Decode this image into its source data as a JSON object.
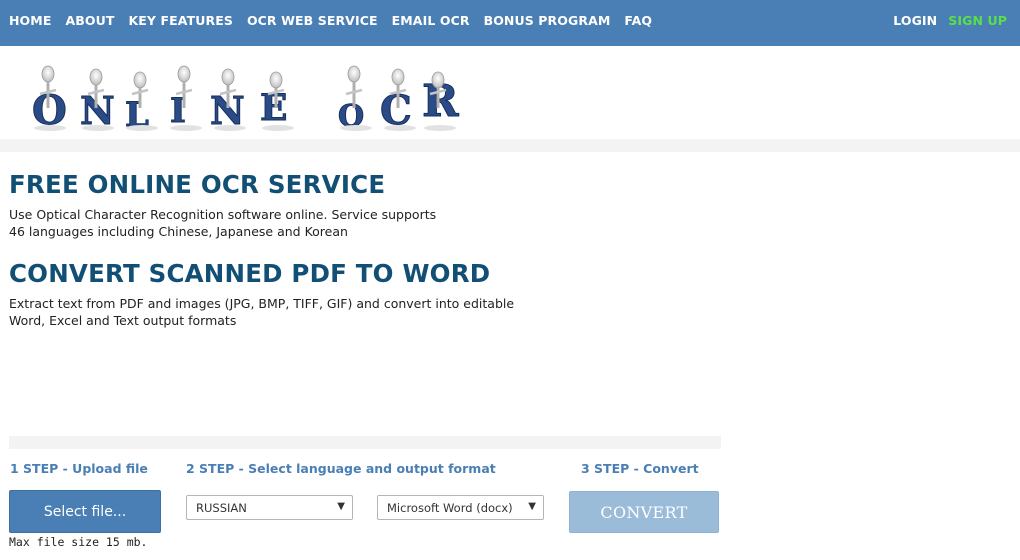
{
  "nav": {
    "left_items": [
      "HOME",
      "ABOUT",
      "KEY FEATURES",
      "OCR WEB SERVICE",
      "EMAIL OCR",
      "BONUS PROGRAM",
      "FAQ"
    ],
    "login": "LOGIN",
    "signup": "SIGN UP"
  },
  "logo": {
    "text": "ONLINE OCR",
    "letters": [
      "O",
      "N",
      "L",
      "I",
      "N",
      "E",
      "O",
      "C",
      "R"
    ]
  },
  "section1": {
    "title": "FREE ONLINE OCR SERVICE",
    "line1": "Use Optical Character Recognition software online. Service supports",
    "line2": "46 languages including Chinese, Japanese and Korean"
  },
  "section2": {
    "title": "CONVERT SCANNED PDF TO WORD",
    "line1": "Extract text from PDF and images (JPG, BMP, TIFF, GIF) and convert into editable",
    "line2": "Word, Excel and Text output formats"
  },
  "steps": {
    "step1": "1 STEP - Upload file",
    "step2": "2 STEP - Select language and output format",
    "step3": "3 STEP - Convert",
    "select_file_label": "Select file...",
    "max_size": "Max file size 15 mb.",
    "language_value": "RUSSIAN",
    "format_value": "Microsoft Word (docx)",
    "convert_label": "CONVERT"
  },
  "colors": {
    "nav_bg": "#4a7fb6",
    "signup": "#58e04a",
    "heading": "#124f75",
    "step_label": "#4a7fb6",
    "convert_disabled": "#9bbcd9",
    "logo_letter": "#2a4b86"
  },
  "icons": {
    "dropdown_arrow": "caret-down-icon"
  }
}
